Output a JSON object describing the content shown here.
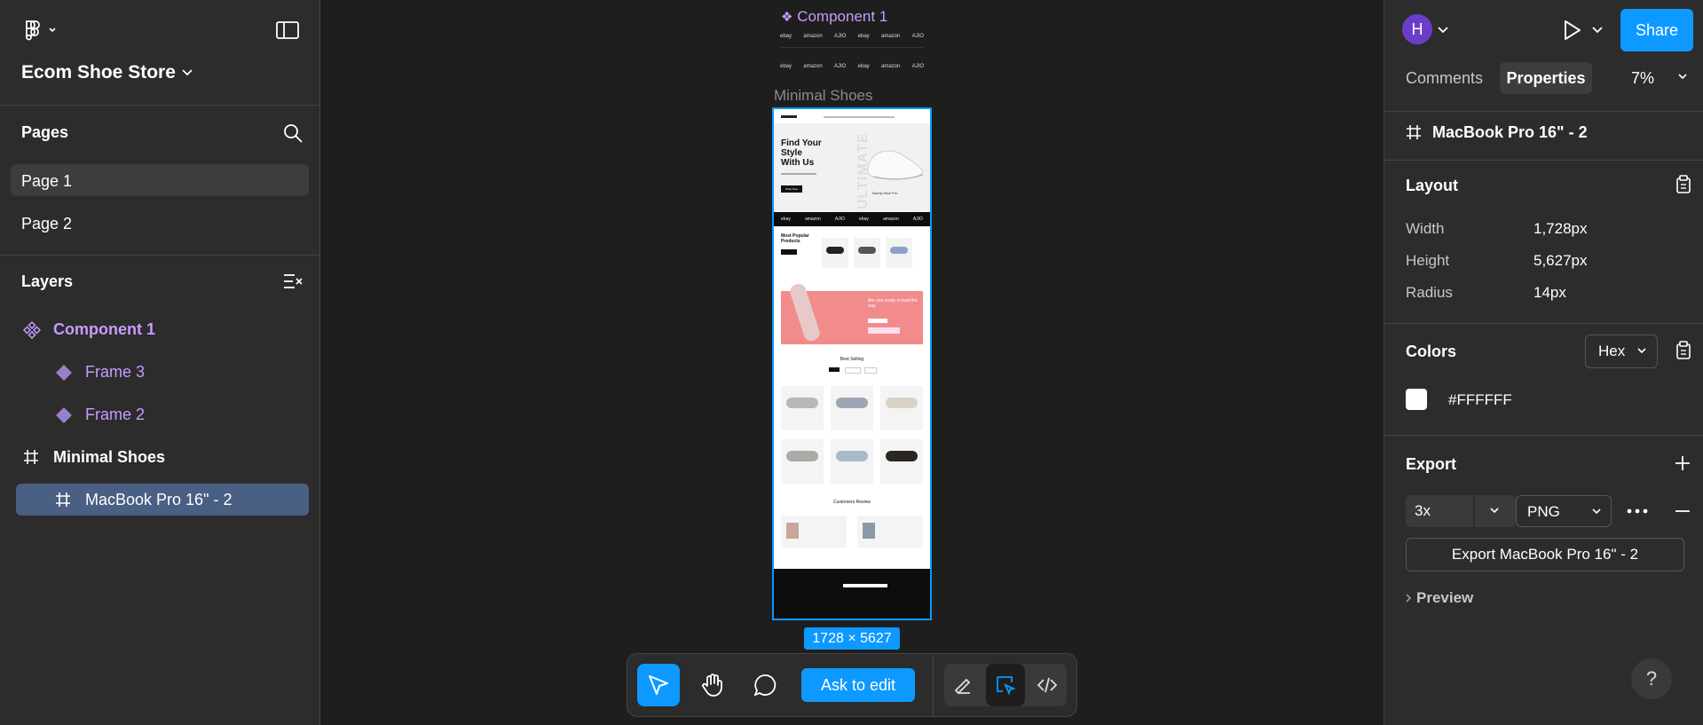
{
  "file": {
    "name": "Ecom Shoe Store"
  },
  "pages": {
    "title": "Pages",
    "items": [
      {
        "label": "Page 1"
      },
      {
        "label": "Page 2"
      }
    ]
  },
  "layers": {
    "title": "Layers",
    "items": [
      {
        "label": "Component 1"
      },
      {
        "label": "Frame 3"
      },
      {
        "label": "Frame 2"
      },
      {
        "label": "Minimal Shoes"
      },
      {
        "label": "MacBook Pro 16\" - 2"
      }
    ]
  },
  "header_right": {
    "avatar_letter": "H",
    "share_label": "Share",
    "tabs": [
      "Comments",
      "Properties"
    ],
    "zoom": "7%"
  },
  "selection": {
    "name": "MacBook Pro 16\" - 2"
  },
  "layout": {
    "title": "Layout",
    "rows": [
      {
        "label": "Width",
        "value": "1,728px"
      },
      {
        "label": "Height",
        "value": "5,627px"
      },
      {
        "label": "Radius",
        "value": "14px"
      }
    ]
  },
  "colors": {
    "title": "Colors",
    "format": "Hex",
    "swatches": [
      {
        "hex": "#FFFFFF"
      }
    ]
  },
  "export": {
    "title": "Export",
    "scale": "3x",
    "format": "PNG",
    "button_label": "Export MacBook Pro 16\" - 2",
    "preview_label": "Preview"
  },
  "canvas": {
    "component_label": "Component 1",
    "frame_label": "Minimal Shoes",
    "dimensions": "1728 × 5627",
    "logo_strip": [
      "ebay",
      "amazon",
      "AJIO",
      "ebay",
      "amazon",
      "AJIO"
    ],
    "hero": {
      "heading": [
        "Find Your",
        "Style",
        "With Us"
      ],
      "watermark": "ULTIMATE",
      "product": "Twenty Nine Pro",
      "cta": "Shop Now"
    },
    "sections": [
      "Most Popular Products",
      "Are you ready to lead the way",
      "Best Selling",
      "Customers Review"
    ]
  },
  "toolbar": {
    "ask_label": "Ask to edit"
  },
  "help": {
    "label": "?"
  },
  "theme": {
    "accent": "#0d99ff",
    "component": "#c79cff",
    "selection_bg": "#4a5f84",
    "panel": "#2c2c2c",
    "canvas": "#1e1e1e"
  }
}
